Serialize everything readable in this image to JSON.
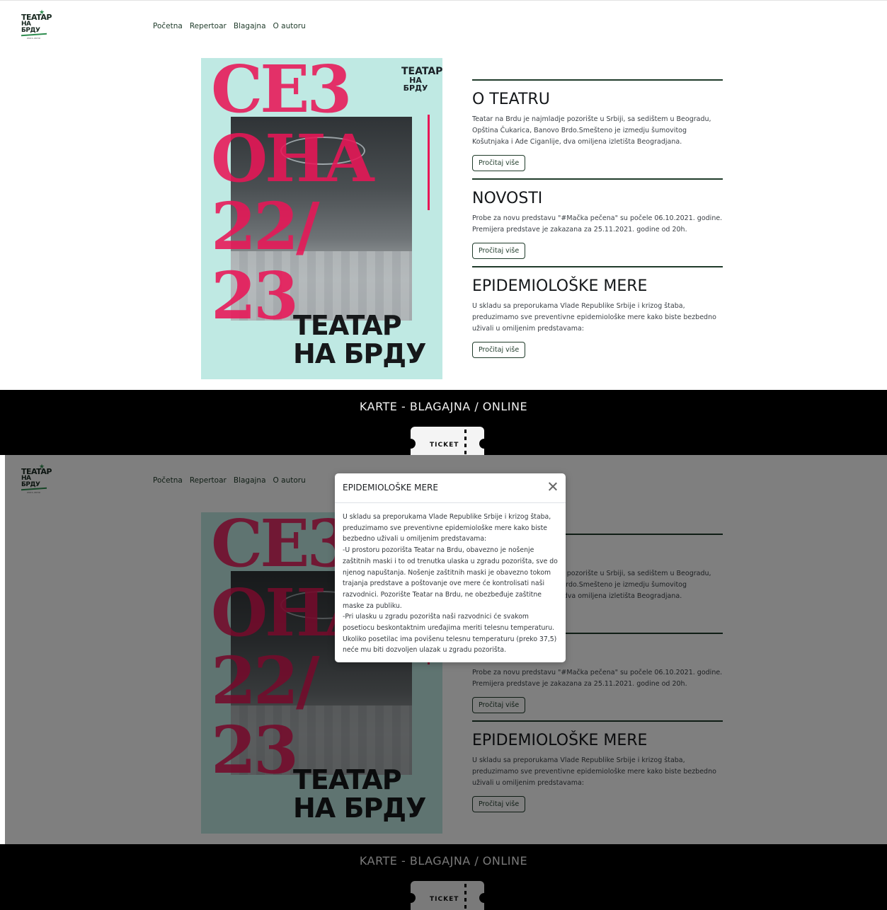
{
  "logo": {
    "line1": "TEATAP",
    "line2": "HA БPДУ",
    "tagline": "2021-2030"
  },
  "nav": {
    "items": [
      "Početna",
      "Repertoar",
      "Blagajna",
      "O autoru"
    ]
  },
  "poster": {
    "lines": [
      "CE3",
      "OHA",
      "22/",
      "23"
    ],
    "title_line1": "TEATAP",
    "title_line2": "HA БРДУ",
    "mini_line1": "TEATAP",
    "mini_line2": "HA БPДУ"
  },
  "sections": [
    {
      "title": "O TEATRU",
      "text": "Teatar na Brdu je najmladje pozorište u Srbiji, sa sedištem u Beogradu, Opština Čukarica, Banovo Brdo.Smešteno je izmedju šumovitog Košutnjaka i Ade Ciganlije, dva omiljena izletišta Beogradjana.",
      "button": "Pročitaj više"
    },
    {
      "title": "NOVOSTI",
      "text": "Probe za novu predstavu \"#Mačka pečena\" su počele 06.10.2021. godine. Premijera predstave je zakazana za 25.11.2021. godine od 20h.",
      "button": "Pročitaj više"
    },
    {
      "title": "EPIDEMIOLOŠKE MERE",
      "text": "U skladu sa preporukama Vlade Republike Srbije i krizog štaba, preduzimamo sve preventivne epidemiološke mere kako biste bezbedno uživali u omiljenim predstavama:",
      "button": "Pročitaj više"
    }
  ],
  "tickets": {
    "heading": "KARTE - BLAGAJNA / ONLINE",
    "ticket_label": "TICKET"
  },
  "modal": {
    "title": "EPIDEMIOLOŠKE MERE",
    "paragraphs": [
      "U skladu sa preporukama Vlade Republike Srbije i krizog štaba, preduzimamo sve preventivne epidemiološke mere kako biste bezbedno uživali u omiljenim predstavama:",
      "-U prostoru pozorišta Teatar na Brdu, obavezno je nošenje zaštitnih maski i to od trenutka ulaska u zgradu pozorišta, sve do njenog napuštanja. Nošenje zaštitnih maski je obavezno tokom trajanja predstave a poštovanje ove mere će kontrolisati naši razvodnici. Pozorište Teatar na Brdu, ne obezbeđuje zaštitne maske za publiku.",
      "-Pri ulasku u zgradu pozorišta naši razvodnici će svakom posetiocu beskontaktnim uređajima meriti telesnu temperaturu. Ukoliko posetilac ima povišenu telesnu temperaturu (preko 37,5) neće mu biti dozvoljen ulazak u zgradu pozorišta."
    ]
  },
  "colors": {
    "accent": "#1f3b2a",
    "poster_red": "#e81656",
    "poster_bg": "#bfe9e3"
  }
}
